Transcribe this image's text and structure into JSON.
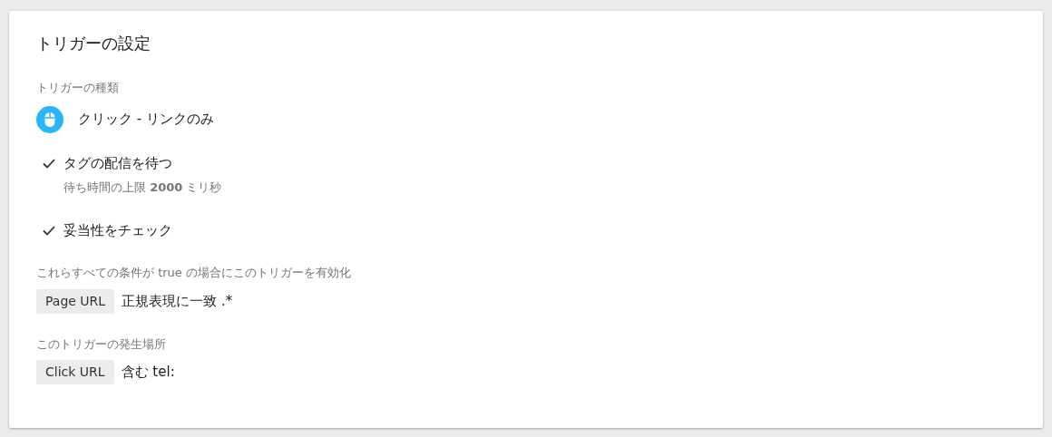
{
  "card": {
    "title": "トリガーの設定",
    "trigger_type": {
      "label": "トリガーの種類",
      "value": "クリック - リンクのみ"
    },
    "options": [
      {
        "label": "タグの配信を待つ",
        "checked": true,
        "detail": "待ち時間の上限 **2000** ミリ秒"
      },
      {
        "label": "妥当性をチェック",
        "checked": true
      }
    ],
    "condition_groups": [
      {
        "label": "これらすべての条件が true の場合にこのトリガーを有効化",
        "conditions": [
          {
            "variable": "Page URL",
            "operator": "正規表現に一致 .*"
          }
        ]
      },
      {
        "label": "このトリガーの発生場所",
        "conditions": [
          {
            "variable": "Click URL",
            "operator": "含む tel:"
          }
        ]
      }
    ]
  }
}
